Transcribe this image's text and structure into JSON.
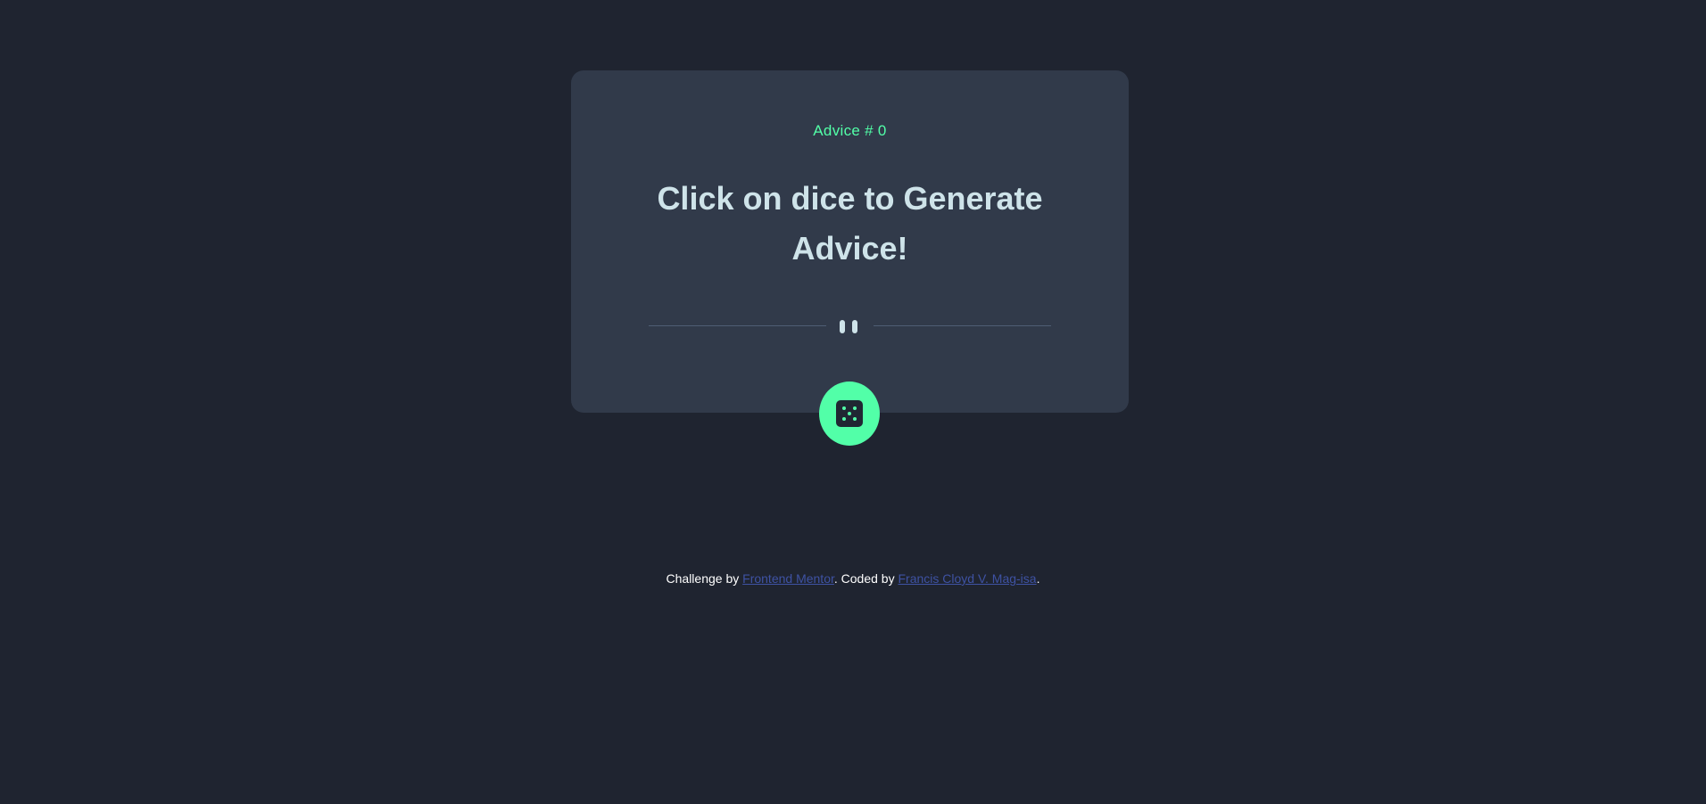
{
  "card": {
    "advice_id": "Advice # 0",
    "advice_text": "Click on dice to Generate Advice!"
  },
  "icons": {
    "divider": "pause-icon",
    "dice": "dice-icon"
  },
  "footer": {
    "prefix": "Challenge by ",
    "link1": "Frontend Mentor",
    "middle": ". Coded by ",
    "link2": "Francis Cloyd V. Mag-isa",
    "suffix": "."
  },
  "colors": {
    "background": "#1f2430",
    "card": "#313a4a",
    "accent": "#52ffa8",
    "text": "#cee3e9",
    "link": "#3e52a3"
  }
}
